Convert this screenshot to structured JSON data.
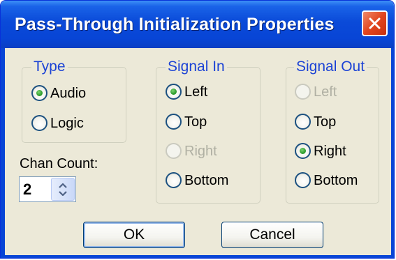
{
  "window": {
    "title": "Pass-Through Initialization Properties"
  },
  "type_group": {
    "label": "Type",
    "options": [
      {
        "label": "Audio",
        "selected": true,
        "enabled": true
      },
      {
        "label": "Logic",
        "selected": false,
        "enabled": true
      }
    ]
  },
  "signal_in_group": {
    "label": "Signal In",
    "options": [
      {
        "label": "Left",
        "selected": true,
        "enabled": true
      },
      {
        "label": "Top",
        "selected": false,
        "enabled": true
      },
      {
        "label": "Right",
        "selected": false,
        "enabled": false
      },
      {
        "label": "Bottom",
        "selected": false,
        "enabled": true
      }
    ]
  },
  "signal_out_group": {
    "label": "Signal Out",
    "options": [
      {
        "label": "Left",
        "selected": false,
        "enabled": false
      },
      {
        "label": "Top",
        "selected": false,
        "enabled": true
      },
      {
        "label": "Right",
        "selected": true,
        "enabled": true
      },
      {
        "label": "Bottom",
        "selected": false,
        "enabled": true
      }
    ]
  },
  "chan_count": {
    "label": "Chan Count:",
    "value": "2"
  },
  "buttons": {
    "ok_label": "OK",
    "cancel_label": "Cancel"
  },
  "icons": {
    "close": "close-icon",
    "spin_arrows": "spin-arrows-icon"
  },
  "colors": {
    "titlebar": "#0845d6",
    "groupbox_label": "#1c43d5",
    "dialog_face": "#ece9d8",
    "close_button": "#e2451f"
  }
}
